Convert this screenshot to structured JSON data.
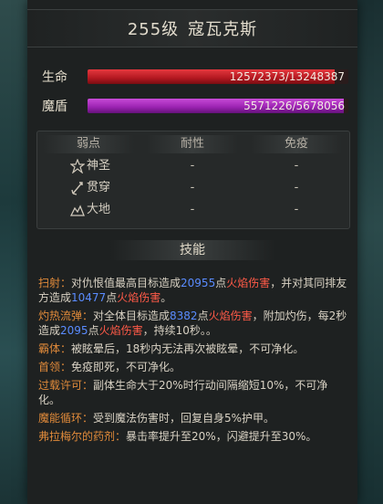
{
  "title": {
    "level": "255级",
    "name": "寇瓦克斯"
  },
  "stats": {
    "hp": {
      "label": "生命",
      "text": "12572373/13248387",
      "current": 12572373,
      "max": 13248387,
      "color": "#c7262c"
    },
    "shield": {
      "label": "魔盾",
      "text": "5571226/5678056",
      "current": 5571226,
      "max": 5678056,
      "color": "#a23bb8"
    }
  },
  "resistances": {
    "headers": [
      "弱点",
      "耐性",
      "免疫"
    ],
    "rows": [
      {
        "icon": "holy-icon",
        "name": "神圣",
        "resist": "-",
        "immune": "-"
      },
      {
        "icon": "pierce-icon",
        "name": "贯穿",
        "resist": "-",
        "immune": "-"
      },
      {
        "icon": "earth-icon",
        "name": "大地",
        "resist": "-",
        "immune": "-"
      }
    ]
  },
  "skills_title": "技能",
  "skills": [
    {
      "name": "扫射：",
      "parts": [
        {
          "t": "对仇恨值最高目标造成"
        },
        {
          "t": "20955",
          "c": "num"
        },
        {
          "t": "点"
        },
        {
          "t": "火焰伤害",
          "c": "fire"
        },
        {
          "t": "，并对其同排友方造成"
        },
        {
          "t": "10477",
          "c": "num"
        },
        {
          "t": "点"
        },
        {
          "t": "火焰伤害",
          "c": "fire"
        },
        {
          "t": "。"
        }
      ]
    },
    {
      "name": "灼热流弹：",
      "parts": [
        {
          "t": "对全体目标造成"
        },
        {
          "t": "8382",
          "c": "num"
        },
        {
          "t": "点"
        },
        {
          "t": "火焰伤害",
          "c": "fire"
        },
        {
          "t": "，附加灼伤，每2秒造成"
        },
        {
          "t": "2095",
          "c": "num"
        },
        {
          "t": "点"
        },
        {
          "t": "火焰伤害",
          "c": "fire"
        },
        {
          "t": "，持续10秒。。"
        }
      ]
    },
    {
      "name": "霸体：",
      "parts": [
        {
          "t": "被眩晕后，18秒内无法再次被眩晕，不可净化。"
        }
      ]
    },
    {
      "name": "首领：",
      "parts": [
        {
          "t": "免疫即死，不可净化。"
        }
      ]
    },
    {
      "name": "过载许可：",
      "parts": [
        {
          "t": "副体生命大于20%时行动间隔缩短10%，不可净化。"
        }
      ]
    },
    {
      "name": "魔能循环：",
      "parts": [
        {
          "t": "受到魔法伤害时，回复自身5%护甲。"
        }
      ]
    },
    {
      "name": "弗拉梅尔的药剂：",
      "parts": [
        {
          "t": "暴击率提升至20%，闪避提升至30%。"
        }
      ]
    }
  ]
}
